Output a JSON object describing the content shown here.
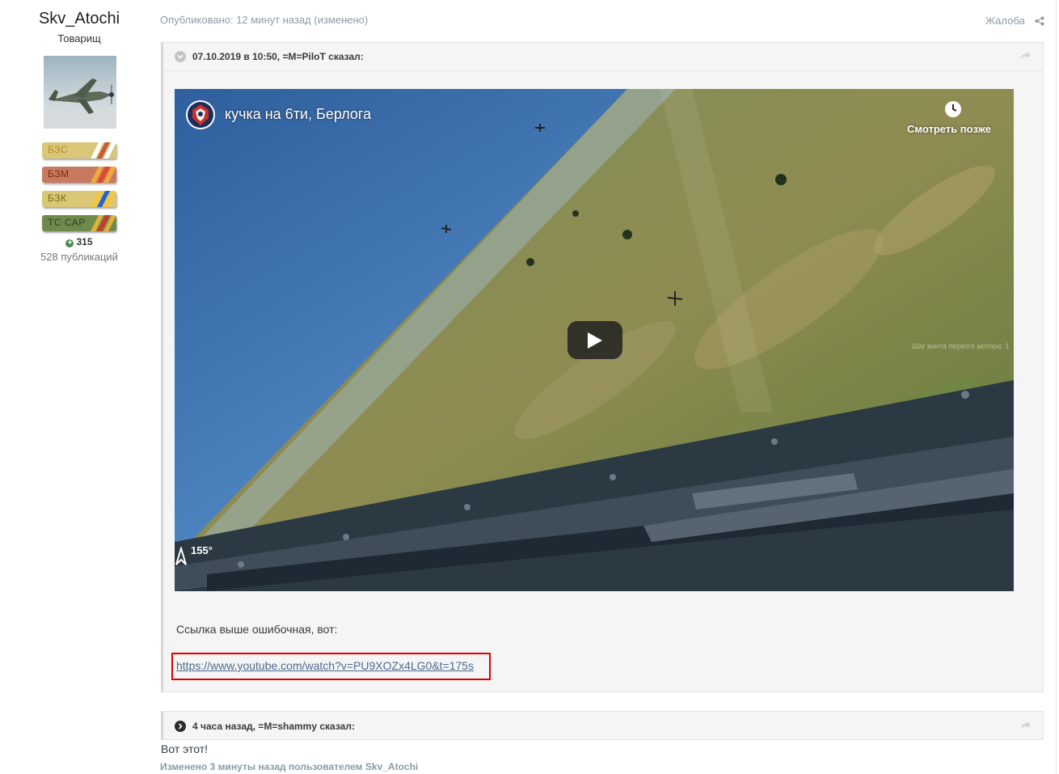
{
  "author": {
    "name": "Skv_Atochi",
    "rank": "Товарищ",
    "badges": [
      {
        "label": "БЗС",
        "bg": "#d9c777",
        "text_color": "#b98a2a",
        "stripes": [
          "#ffffff",
          "#c85a3a",
          "#ffffff"
        ]
      },
      {
        "label": "БЗМ",
        "bg": "#c77a60",
        "text_color": "#7a2a16",
        "stripes": [
          "#f2a93b",
          "#e04a2a",
          "#f2a93b"
        ]
      },
      {
        "label": "БЗК",
        "bg": "#d9c777",
        "text_color": "#7a6318",
        "stripes": [
          "#f2c53b",
          "#2a63c8",
          "#f2c53b"
        ]
      },
      {
        "label": "ТС САР",
        "bg": "#6f8a4d",
        "text_color": "#2f3f20",
        "stripes": [
          "#e0b23a",
          "#c83a2a",
          "#e0b23a"
        ]
      }
    ],
    "reputation": "315",
    "posts": "528 публикаций"
  },
  "post": {
    "meta": "Опубликовано: 12 минут назад (изменено)",
    "report_label": "Жалоба",
    "quote1": {
      "citation": "07.10.2019 в 10:50, =M=PiloT сказал:",
      "video": {
        "title": "кучка на 6ти, Берлога",
        "watch_later": "Смотреть позже",
        "compass": "155°",
        "hud_text": "Шаг винта первого мотора: 1"
      },
      "text": "Ссылка выше ошибочная, вот:",
      "link": "https://www.youtube.com/watch?v=PU9XOZx4LG0&t=175s"
    },
    "quote2": {
      "citation": "4 часа назад, =M=shammy сказал:"
    },
    "reply": "Вот этот!",
    "edited_note": "Изменено 3 минуты назад пользователем Skv_Atochi"
  },
  "colors": {
    "link": "#4b6a8f",
    "highlight": "#e00000",
    "meta": "#8d9aa6",
    "quote_bg": "#f5f5f5"
  }
}
